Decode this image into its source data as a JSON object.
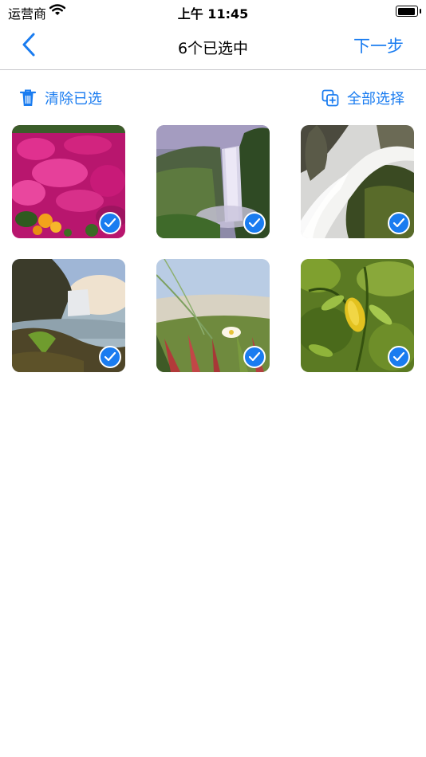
{
  "status_bar": {
    "carrier": "运营商",
    "time": "上午 11:45",
    "battery_level": 1.0
  },
  "nav": {
    "title": "6个已选中",
    "next_label": "下一步"
  },
  "toolbar": {
    "clear_label": "清除已选",
    "select_all_label": "全部选择"
  },
  "colors": {
    "accent": "#1a7cf0",
    "divider": "#c8c8cc"
  },
  "photos": [
    {
      "subject": "pink flowers",
      "selected": true
    },
    {
      "subject": "waterfall cliff",
      "selected": true
    },
    {
      "subject": "rushing water",
      "selected": true
    },
    {
      "subject": "waterfall coast",
      "selected": true
    },
    {
      "subject": "beach grass",
      "selected": true
    },
    {
      "subject": "green leaves",
      "selected": true
    }
  ]
}
